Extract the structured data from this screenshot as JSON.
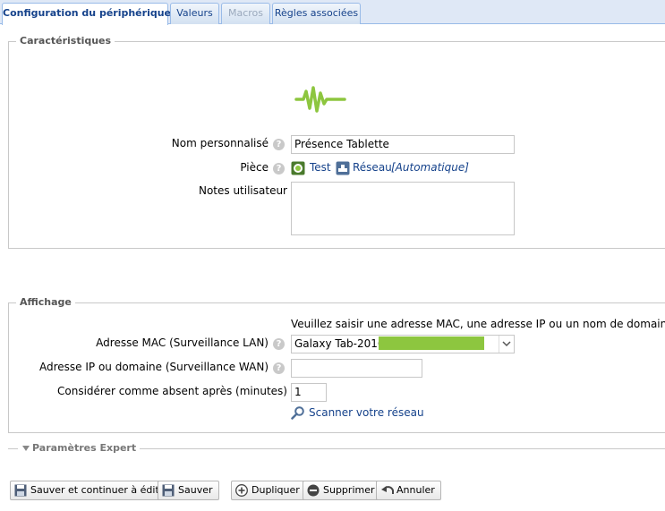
{
  "tabs": [
    {
      "label": "Configuration du périphérique",
      "state": "active"
    },
    {
      "label": "Valeurs",
      "state": "normal"
    },
    {
      "label": "Macros",
      "state": "disabled"
    },
    {
      "label": "Règles associées",
      "state": "normal"
    }
  ],
  "characteristics": {
    "legend": "Caractéristiques",
    "device_icon": "heartbeat-icon",
    "name_label": "Nom personnalisé",
    "name_value": "Présence Tablette",
    "room_label": "Pièce",
    "room_value": "Test",
    "network_value": "Réseau",
    "network_mode": "[Automatique]",
    "notes_label": "Notes utilisateur",
    "notes_value": ""
  },
  "display": {
    "legend": "Affichage",
    "hint": "Veuillez saisir une adresse MAC, une adresse IP ou un nom de domaine",
    "mac_label": "Adresse MAC (Surveillance LAN)",
    "mac_value": "Galaxy Tab-2016",
    "ip_label": "Adresse IP ou domaine (Surveillance WAN)",
    "ip_value": "",
    "absent_label": "Considérer comme absent après (minutes)",
    "absent_value": "1",
    "scan_link": "Scanner votre réseau"
  },
  "expert": {
    "label": "Paramètres Expert"
  },
  "buttons": {
    "save_continue": "Sauver et continuer à éditer",
    "save": "Sauver",
    "duplicate": "Dupliquer",
    "delete": "Supprimer",
    "cancel": "Annuler"
  },
  "colors": {
    "accent": "#15428b",
    "icon_green": "#8dc63f",
    "redaction": "#8dc63f"
  }
}
